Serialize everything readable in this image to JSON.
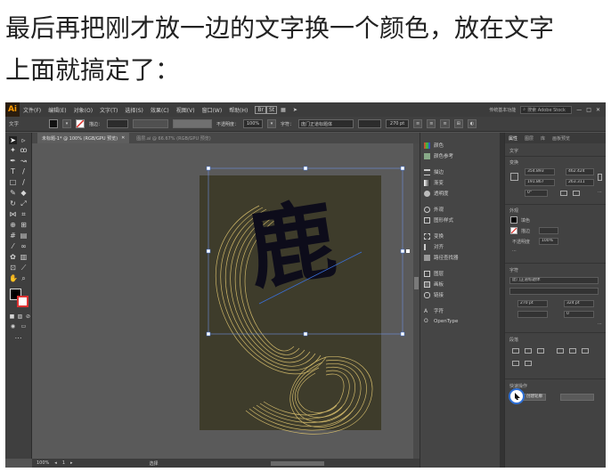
{
  "caption": {
    "line1": "最后再把刚才放一边的文字换一个颜色，放在文字",
    "line2": "上面就搞定了："
  },
  "menubar": {
    "logo": "Ai",
    "items": [
      "文件(F)",
      "编辑(E)",
      "对象(O)",
      "文字(T)",
      "选择(S)",
      "效果(C)",
      "视图(V)",
      "窗口(W)",
      "帮助(H)"
    ],
    "workspace": "传统基本功能",
    "search_placeholder": "搜索 Adobe Stock"
  },
  "control": {
    "label": "文字",
    "stroke_label": "描边：",
    "opacity_label": "不透明度：",
    "opacity_value": "100%",
    "char_label": "字符：",
    "font_value": "庞门正道标题体",
    "size_value": "270 pt"
  },
  "doc": {
    "active_tab": "未标题-1* @ 100% (RGB/GPU 预览)",
    "inactive_tab": "图层.ai @ 66.67% (RGB/GPU 预览)"
  },
  "artwork": {
    "glyph": "鹿",
    "glyph_color": "#0d0c1a",
    "line_color": "#d6bd6c"
  },
  "mid_panel": {
    "items": [
      "颜色",
      "颜色参考",
      "描边",
      "渐变",
      "透明度",
      "外观",
      "图形样式",
      "变换",
      "对齐",
      "路径查找器",
      "图层",
      "画板",
      "链接",
      "字符",
      "OpenType"
    ]
  },
  "properties": {
    "tabs": [
      "属性",
      "图层",
      "库",
      "画板预览"
    ],
    "section_type": "文字",
    "section_transform": "变换",
    "x": "354.893",
    "y": "191.867",
    "w": "462.424",
    "h": "263.311",
    "angle": "0°",
    "section_appearance": "外观",
    "fill_label": "填色",
    "stroke_label": "描边",
    "opacity_label": "不透明度",
    "opacity_value": "100%",
    "section_character": "字符",
    "font": "庞门正道标题体",
    "font_size": "270 pt",
    "leading": "324 pt",
    "tracking": "0",
    "section_paragraph": "段落",
    "section_actions": "快速操作",
    "action_button": "创建轮廓"
  },
  "status": {
    "zoom": "100%",
    "page": "1",
    "tool": "选择"
  }
}
